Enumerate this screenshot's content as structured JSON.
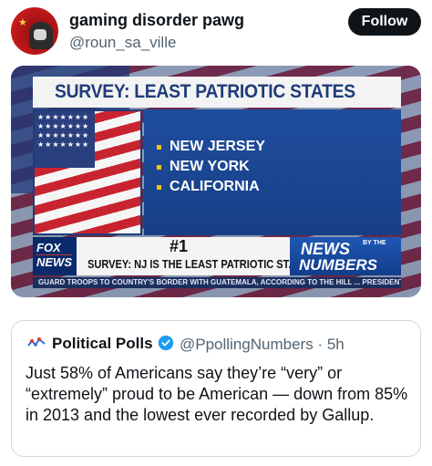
{
  "author": {
    "display_name": "gaming disorder pawg",
    "handle": "@roun_sa_ville"
  },
  "follow_button": "Follow",
  "media": {
    "title": "SURVEY: LEAST PATRIOTIC STATES",
    "states": [
      "NEW JERSEY",
      "NEW YORK",
      "CALIFORNIA"
    ],
    "rank": "#1",
    "headline": "SURVEY: NJ IS THE LEAST PATRIOTIC STATE",
    "channel_logo_top": "FOX",
    "channel_logo_bottom": "NEWS",
    "segment_logo_top": "NEWS",
    "segment_logo_by": "BY THE",
    "segment_logo_bottom": "NUMBERS",
    "ticker": "GUARD TROOPS TO COUNTRY'S BORDER WITH GUATEMALA, ACCORDING TO THE HILL ... PRESIDENT TRU"
  },
  "quoted_post": {
    "name": "Political Polls",
    "handle_time": "@PpollingNumbers · 5h",
    "text": "Just 58% of Americans say they’re “very” or “extremely” proud to be American — down from 85% in 2013 and the lowest ever recorded by Gallup."
  }
}
